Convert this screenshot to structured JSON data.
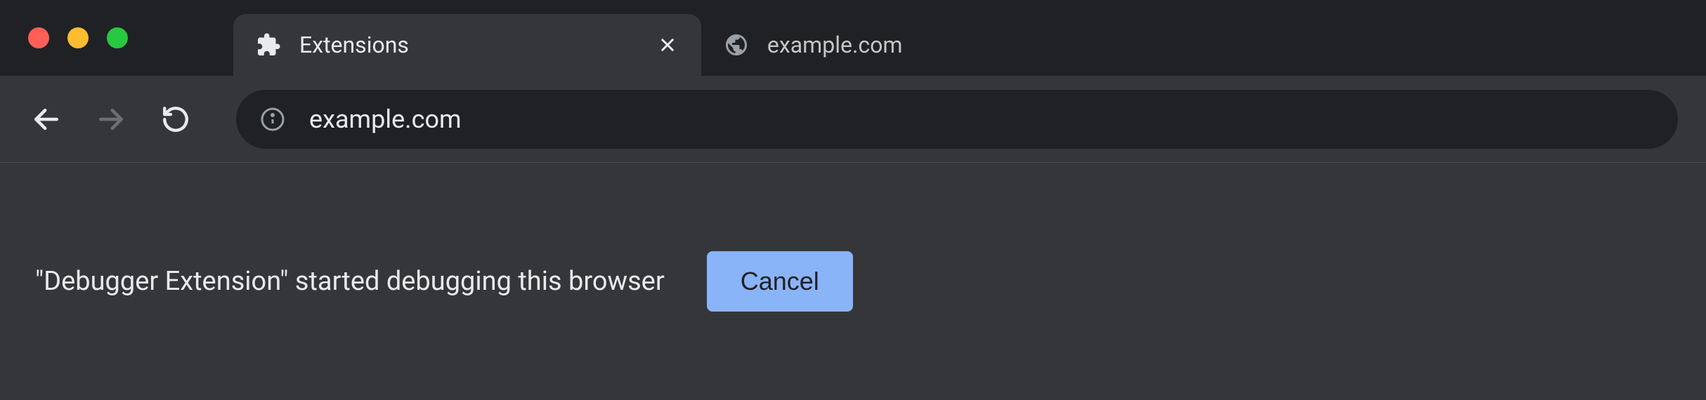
{
  "tabs": [
    {
      "title": "Extensions",
      "icon": "puzzle-piece",
      "active": true
    },
    {
      "title": "example.com",
      "icon": "globe",
      "active": false
    }
  ],
  "address_bar": {
    "url": "example.com"
  },
  "info_bar": {
    "message": "\"Debugger Extension\" started debugging this browser",
    "button_label": "Cancel"
  }
}
